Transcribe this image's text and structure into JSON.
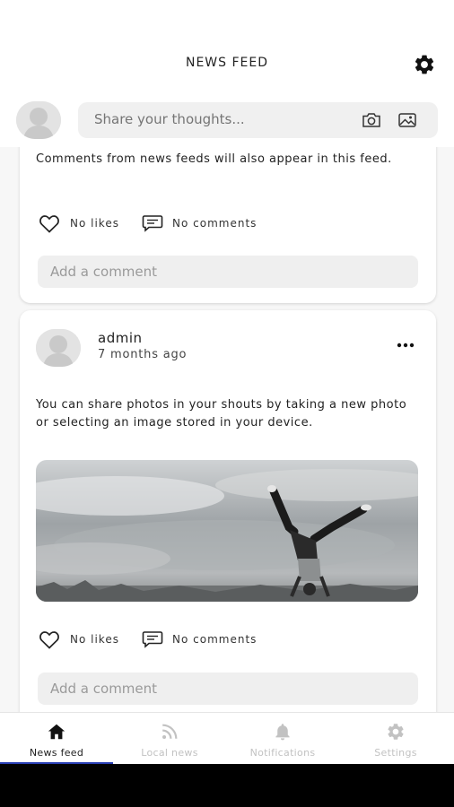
{
  "header": {
    "title": "NEWS FEED",
    "settings_icon": "gear-icon"
  },
  "composer": {
    "placeholder": "Share your thoughts...",
    "icons": [
      "camera-icon",
      "image-icon"
    ]
  },
  "posts": [
    {
      "text": "Comments from news feeds will also appear in this feed.",
      "likes_label": "No likes",
      "comments_label": "No comments",
      "comment_placeholder": "Add a comment"
    },
    {
      "author": "admin",
      "timestamp": "7 months ago",
      "text": "You can share photos in your shouts by taking a new photo or selecting an image stored in your device.",
      "likes_label": "No likes",
      "comments_label": "No comments",
      "comment_placeholder": "Add a comment"
    }
  ],
  "nav": {
    "items": [
      {
        "label": "News feed",
        "icon": "home-icon",
        "active": true
      },
      {
        "label": "Local news",
        "icon": "rss-icon",
        "active": false
      },
      {
        "label": "Notifications",
        "icon": "bell-icon",
        "active": false
      },
      {
        "label": "Settings",
        "icon": "gear-icon",
        "active": false
      }
    ]
  },
  "colors": {
    "active_indicator": "#2a3fb5",
    "inactive_nav": "#c2c2c2",
    "input_bg": "#efefef"
  }
}
